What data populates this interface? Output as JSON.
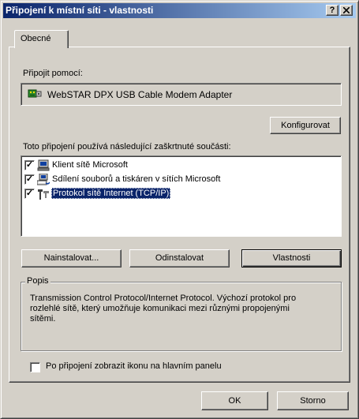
{
  "window": {
    "title": "Připojení k místní síti - vlastnosti",
    "help_label": "?",
    "close_label": "✕"
  },
  "tabs": [
    {
      "label": "Obecné"
    }
  ],
  "connect_using": {
    "label": "Připojit pomocí:",
    "adapter_icon": "network-adapter-icon",
    "adapter_name": "WebSTAR DPX USB Cable Modem Adapter",
    "configure_label": "Konfigurovat"
  },
  "components": {
    "label": "Toto připojení používá následující zaškrtnuté součásti:",
    "items": [
      {
        "label": "Klient sítě Microsoft",
        "checked": true,
        "icon": "network-client-icon"
      },
      {
        "label": "Sdílení souborů a tiskáren v sítích Microsoft",
        "checked": true,
        "icon": "file-printer-sharing-icon"
      },
      {
        "label": "Protokol sítě Internet (TCP/IP)",
        "checked": true,
        "selected": true,
        "icon": "protocol-icon"
      }
    ],
    "install_label": "Nainstalovat...",
    "uninstall_label": "Odinstalovat",
    "properties_label": "Vlastnosti"
  },
  "description": {
    "legend": "Popis",
    "text": "Transmission Control Protocol/Internet Protocol. Výchozí protokol pro rozlehlé sítě, který umožňuje komunikaci mezi různými propojenými sítěmi."
  },
  "show_icon": {
    "label": "Po připojení zobrazit ikonu na hlavním panelu",
    "checked": false
  },
  "footer": {
    "ok_label": "OK",
    "cancel_label": "Storno"
  },
  "colors": {
    "title_gradient_start": "#0a246a",
    "title_gradient_end": "#a6caf0",
    "face": "#d4d0c8",
    "selection": "#0a246a"
  }
}
